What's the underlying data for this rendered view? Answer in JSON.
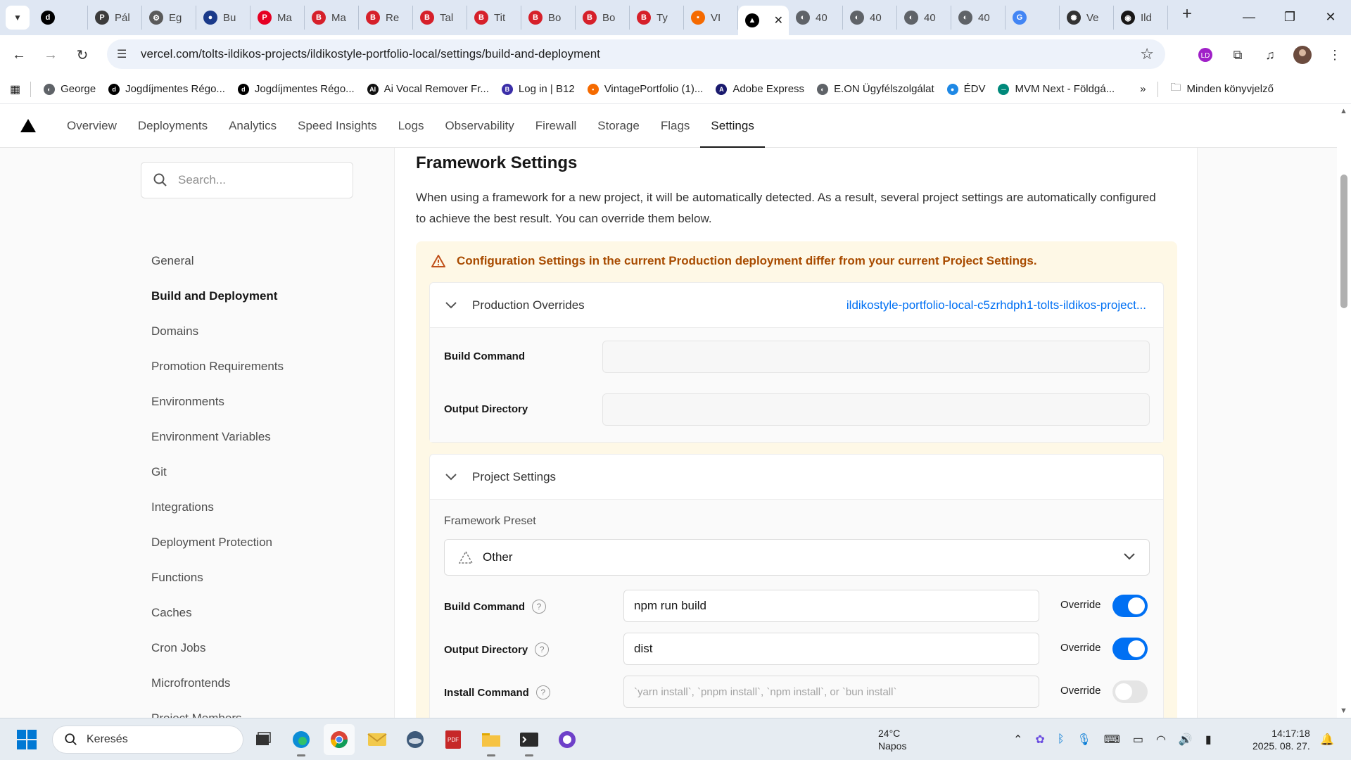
{
  "browser": {
    "tabs": [
      {
        "label": "",
        "icon": "tiktok-icon",
        "color": "#000000",
        "glyph": "d"
      },
      {
        "label": "Pál",
        "icon": "site-icon",
        "color": "#3b3b3b",
        "glyph": "P"
      },
      {
        "label": "Eg",
        "icon": "gear-site-icon",
        "color": "#5a5a5a",
        "glyph": "⚙"
      },
      {
        "label": "Bu",
        "icon": "site-icon",
        "color": "#1a3a8a",
        "glyph": "●"
      },
      {
        "label": "Ma",
        "icon": "pinterest-icon",
        "color": "#e60023",
        "glyph": "P"
      },
      {
        "label": "Ma",
        "icon": "b12-icon",
        "color": "#d6202a",
        "glyph": "B"
      },
      {
        "label": "Re",
        "icon": "b12-icon",
        "color": "#d6202a",
        "glyph": "B"
      },
      {
        "label": "Tal",
        "icon": "b12-icon",
        "color": "#d6202a",
        "glyph": "B"
      },
      {
        "label": "Tit",
        "icon": "b12-icon",
        "color": "#d6202a",
        "glyph": "B"
      },
      {
        "label": "Bo",
        "icon": "b12-icon",
        "color": "#d6202a",
        "glyph": "B"
      },
      {
        "label": "Bo",
        "icon": "b12-icon",
        "color": "#d6202a",
        "glyph": "B"
      },
      {
        "label": "Ty",
        "icon": "b12-icon",
        "color": "#d6202a",
        "glyph": "B"
      },
      {
        "label": "VI",
        "icon": "site-icon",
        "color": "#f56a00",
        "glyph": "▪"
      },
      {
        "label": "",
        "icon": "vercel-icon",
        "color": "#000000",
        "glyph": "▲",
        "active": true
      },
      {
        "label": "40",
        "icon": "globe-icon",
        "color": "#5f6368",
        "glyph": "◐"
      },
      {
        "label": "40",
        "icon": "globe-icon",
        "color": "#5f6368",
        "glyph": "◐"
      },
      {
        "label": "40",
        "icon": "globe-icon",
        "color": "#5f6368",
        "glyph": "◐"
      },
      {
        "label": "40",
        "icon": "globe-icon",
        "color": "#5f6368",
        "glyph": "◐"
      },
      {
        "label": "",
        "icon": "translate-icon",
        "color": "#4285f4",
        "glyph": "G"
      },
      {
        "label": "Ve",
        "icon": "openai-icon",
        "color": "#333333",
        "glyph": "✺"
      },
      {
        "label": "Ild",
        "icon": "github-icon",
        "color": "#181717",
        "glyph": "◉"
      }
    ],
    "url": "vercel.com/tolts-ildikos-projects/ildikostyle-portfolio-local/settings/build-and-deployment",
    "bookmarks": [
      {
        "label": "George",
        "icon": "globe-icon",
        "color": "#5f6368",
        "glyph": "◐"
      },
      {
        "label": "Jogdíjmentes Régo...",
        "icon": "tiktok-icon",
        "color": "#000000",
        "glyph": "d"
      },
      {
        "label": "Jogdíjmentes Régo...",
        "icon": "tiktok-icon",
        "color": "#000000",
        "glyph": "d"
      },
      {
        "label": "Ai Vocal Remover Fr...",
        "icon": "ai-icon",
        "color": "#111111",
        "glyph": "AI"
      },
      {
        "label": "Log in | B12",
        "icon": "b12-icon",
        "color": "#3b2ea8",
        "glyph": "B"
      },
      {
        "label": "VintagePortfolio (1)...",
        "icon": "site-icon",
        "color": "#f56a00",
        "glyph": "▪"
      },
      {
        "label": "Adobe Express",
        "icon": "adobe-icon",
        "color": "#1a1a6e",
        "glyph": "A"
      },
      {
        "label": "E.ON Ügyfélszolgálat",
        "icon": "globe-icon",
        "color": "#5f6368",
        "glyph": "◐"
      },
      {
        "label": "ÉDV",
        "icon": "water-icon",
        "color": "#1e88e5",
        "glyph": "●"
      },
      {
        "label": "MVM Next - Földgá...",
        "icon": "site-icon",
        "color": "#00897b",
        "glyph": "─"
      }
    ],
    "all_bookmarks": "Minden könyvjelző"
  },
  "project_nav": {
    "items": [
      "Overview",
      "Deployments",
      "Analytics",
      "Speed Insights",
      "Logs",
      "Observability",
      "Firewall",
      "Storage",
      "Flags",
      "Settings"
    ],
    "active": "Settings"
  },
  "sidebar": {
    "search_placeholder": "Search...",
    "items": [
      "General",
      "Build and Deployment",
      "Domains",
      "Promotion Requirements",
      "Environments",
      "Environment Variables",
      "Git",
      "Integrations",
      "Deployment Protection",
      "Functions",
      "Caches",
      "Cron Jobs",
      "Microfrontends",
      "Project Members"
    ],
    "active": "Build and Deployment"
  },
  "framework": {
    "title": "Framework Settings",
    "description": "When using a framework for a new project, it will be automatically detected. As a result, several project settings are automatically configured to achieve the best result. You can override them below.",
    "warning": "Configuration Settings in the current Production deployment differ from your current Project Settings.",
    "production_overrides": {
      "title": "Production Overrides",
      "deployment_link": "ildikostyle-portfolio-local-c5zrhdph1-tolts-ildikos-project...",
      "build_command_label": "Build Command",
      "output_directory_label": "Output Directory"
    },
    "project_settings": {
      "title": "Project Settings",
      "preset_label": "Framework Preset",
      "preset_value": "Other",
      "override_label": "Override",
      "fields": [
        {
          "label": "Build Command",
          "value": "npm run build",
          "override": true
        },
        {
          "label": "Output Directory",
          "value": "dist",
          "override": true
        },
        {
          "label": "Install Command",
          "placeholder": "`yarn install`, `pnpm install`, `npm install`, or `bun install`",
          "override": false
        }
      ]
    }
  },
  "taskbar": {
    "search_placeholder": "Keresés",
    "weather_temp": "24°C",
    "weather_desc": "Napos",
    "time": "14:17:18",
    "date": "2025. 08. 27."
  },
  "colors": {
    "accent": "#0070f3",
    "warning": "#a84b00",
    "warning_bg": "#fef8e6"
  }
}
